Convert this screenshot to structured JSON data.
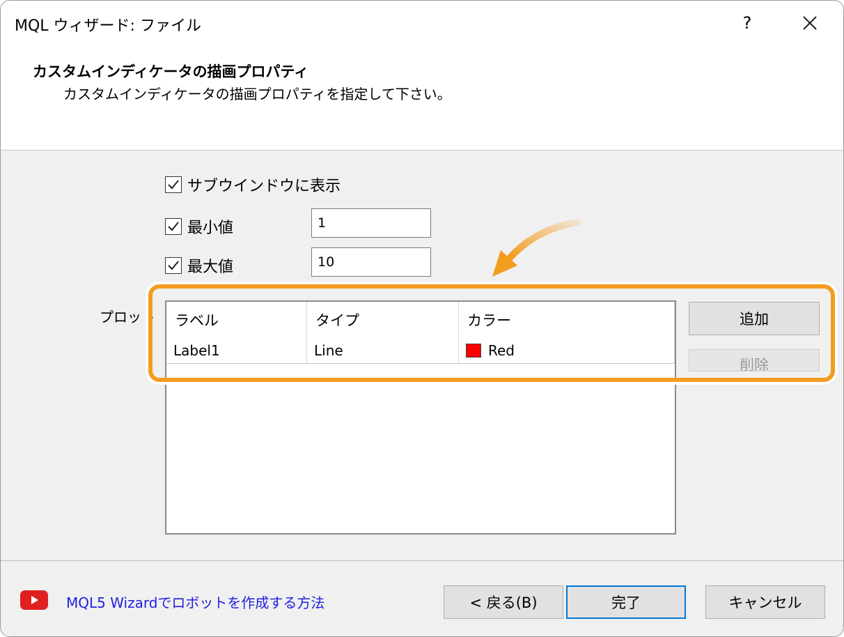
{
  "window": {
    "title": "MQL ウィザード: ファイル",
    "help_label": "?"
  },
  "header": {
    "title": "カスタムインディケータの描画プロパティ",
    "description": "カスタムインディケータの描画プロパティを指定して下さい。"
  },
  "options": {
    "subwindow_label": "サブウインドウに表示",
    "subwindow_checked": true,
    "min_label": "最小値",
    "min_checked": true,
    "min_value": "1",
    "max_label": "最大値",
    "max_checked": true,
    "max_value": "10"
  },
  "plot": {
    "label": "プロット",
    "columns": [
      "ラベル",
      "タイプ",
      "カラー"
    ],
    "rows": [
      {
        "label": "Label1",
        "type": "Line",
        "color_name": "Red",
        "color": "#ff0000"
      }
    ],
    "add_button": "追加",
    "delete_button": "削除"
  },
  "footer": {
    "link_text": "MQL5 Wizardでロボットを作成する方法",
    "back_button": "< 戻る(B)",
    "finish_button": "完了",
    "cancel_button": "キャンセル"
  },
  "accent_color": "#f39c1e",
  "icons": [
    "close-icon",
    "checkmark-icon",
    "youtube-icon",
    "callout-arrow-icon"
  ]
}
